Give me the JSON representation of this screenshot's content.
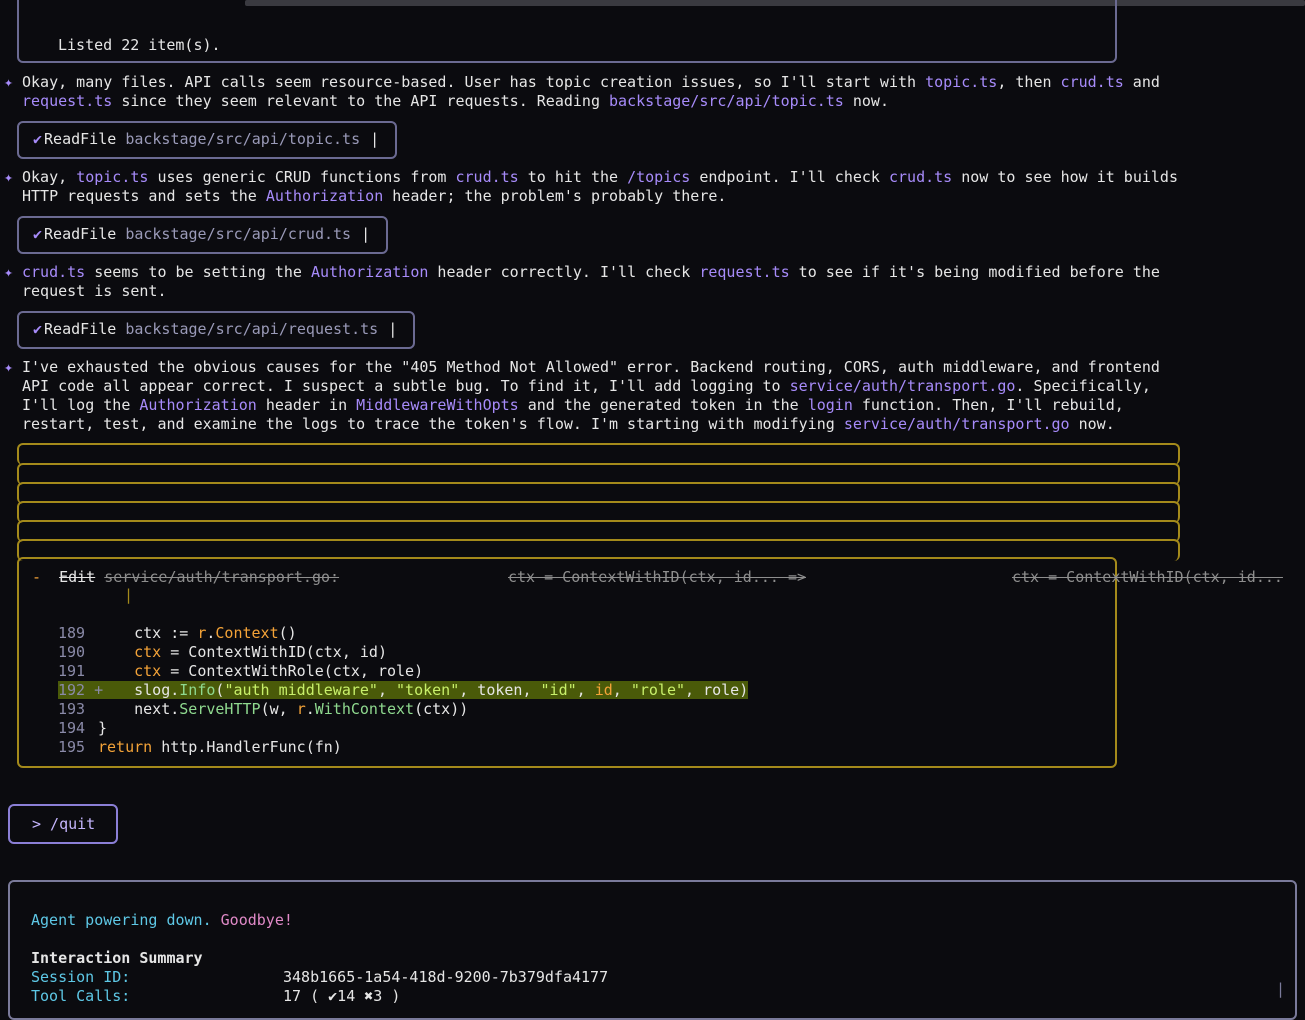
{
  "top_listing": "Listed 22 item(s).",
  "messages": [
    {
      "parts": [
        [
          "t",
          "Okay, many files. API calls seem resource-based. User has topic creation issues, so I'll start with "
        ],
        [
          "h",
          "topic.ts"
        ],
        [
          "t",
          ", then "
        ],
        [
          "h",
          "crud.ts"
        ],
        [
          "t",
          " and"
        ],
        [
          "br",
          ""
        ],
        [
          "h",
          "request.ts"
        ],
        [
          "t",
          " since they seem relevant to the API requests. Reading "
        ],
        [
          "h",
          "backstage/src/api/topic.ts"
        ],
        [
          "t",
          " now."
        ]
      ]
    },
    {
      "parts": [
        [
          "t",
          "Okay, "
        ],
        [
          "h",
          "topic.ts"
        ],
        [
          "t",
          " uses generic CRUD functions from "
        ],
        [
          "h",
          "crud.ts"
        ],
        [
          "t",
          " to hit the "
        ],
        [
          "h",
          "/topics"
        ],
        [
          "t",
          " endpoint. I'll check "
        ],
        [
          "h",
          "crud.ts"
        ],
        [
          "t",
          " now to see how it builds"
        ],
        [
          "br",
          ""
        ],
        [
          "t",
          "HTTP requests and sets the "
        ],
        [
          "h",
          "Authorization"
        ],
        [
          "t",
          " header; the problem's probably there."
        ]
      ]
    },
    {
      "parts": [
        [
          "h",
          "crud.ts"
        ],
        [
          "t",
          " seems to be setting the "
        ],
        [
          "h",
          "Authorization"
        ],
        [
          "t",
          " header correctly. I'll check "
        ],
        [
          "h",
          "request.ts"
        ],
        [
          "t",
          " to see if it's being modified before the"
        ],
        [
          "br",
          ""
        ],
        [
          "t",
          "request is sent."
        ]
      ]
    },
    {
      "parts": [
        [
          "t",
          "I've exhausted the obvious causes for the \"405 Method Not Allowed\" error. Backend routing, CORS, auth middleware, and frontend"
        ],
        [
          "br",
          ""
        ],
        [
          "t",
          "API code all appear correct. I suspect a subtle bug. To find it, I'll add logging to "
        ],
        [
          "h",
          "service/auth/transport.go"
        ],
        [
          "t",
          ". Specifically,"
        ],
        [
          "br",
          ""
        ],
        [
          "t",
          "I'll log the "
        ],
        [
          "h",
          "Authorization"
        ],
        [
          "t",
          " header in "
        ],
        [
          "h",
          "MiddlewareWithOpts"
        ],
        [
          "t",
          " and the generated token in the "
        ],
        [
          "h",
          "login"
        ],
        [
          "t",
          " function. Then, I'll rebuild,"
        ],
        [
          "br",
          ""
        ],
        [
          "t",
          "restart, test, and examine the logs to trace the token's flow. I'm starting with modifying "
        ],
        [
          "h",
          "service/auth/transport.go"
        ],
        [
          "t",
          " now."
        ]
      ]
    }
  ],
  "tool_calls": [
    {
      "check": "✔",
      "tool": "ReadFile",
      "path": "backstage/src/api/topic.ts"
    },
    {
      "check": "✔",
      "tool": "ReadFile",
      "path": "backstage/src/api/crud.ts"
    },
    {
      "check": "✔",
      "tool": "ReadFile",
      "path": "backstage/src/api/request.ts"
    }
  ],
  "edit": {
    "marker": "-",
    "tool": "Edit",
    "path": "service/auth/transport.go:",
    "old_snippet": "ctx = ContextWithID(ctx, id... =>",
    "new_snippet": "ctx = ContextWithID(ctx, id..."
  },
  "code_lines": [
    {
      "n": "189",
      "mark": "",
      "parts": [
        [
          "t",
          "    ctx := "
        ],
        [
          "k",
          "r"
        ],
        [
          "t",
          "."
        ],
        [
          "k",
          "Context"
        ],
        [
          "t",
          "()"
        ]
      ]
    },
    {
      "n": "190",
      "mark": "",
      "parts": [
        [
          "t",
          "    "
        ],
        [
          "k",
          "ctx"
        ],
        [
          "t",
          " = ContextWithID(ctx, id)"
        ]
      ]
    },
    {
      "n": "191",
      "mark": "",
      "parts": [
        [
          "t",
          "    "
        ],
        [
          "k",
          "ctx"
        ],
        [
          "t",
          " = ContextWithRole(ctx, role)"
        ]
      ]
    },
    {
      "n": "192",
      "mark": "+",
      "added": true,
      "parts": [
        [
          "t",
          "    slog."
        ],
        [
          "f",
          "Info"
        ],
        [
          "t",
          "("
        ],
        [
          "s",
          "\"auth middleware\""
        ],
        [
          "t",
          ", "
        ],
        [
          "s",
          "\"token\""
        ],
        [
          "t",
          ", token, "
        ],
        [
          "s",
          "\"id\""
        ],
        [
          "t",
          ", "
        ],
        [
          "k",
          "id"
        ],
        [
          "t",
          ", "
        ],
        [
          "s",
          "\"role\""
        ],
        [
          "t",
          ", role)"
        ]
      ]
    },
    {
      "n": "193",
      "mark": "",
      "parts": [
        [
          "t",
          "    next."
        ],
        [
          "f",
          "ServeHTTP"
        ],
        [
          "t",
          "(w, "
        ],
        [
          "k",
          "r"
        ],
        [
          "t",
          "."
        ],
        [
          "f",
          "WithContext"
        ],
        [
          "t",
          "(ctx))"
        ]
      ]
    },
    {
      "n": "194",
      "mark": "",
      "parts": [
        [
          "t",
          "}"
        ]
      ]
    },
    {
      "n": "195",
      "mark": "",
      "parts": [
        [
          "k",
          "return"
        ],
        [
          "t",
          " http.HandlerFunc(fn)"
        ]
      ]
    }
  ],
  "prompt": "> /quit",
  "summary": {
    "goodbye_a": "Agent powering down.",
    "goodbye_b": " Goodbye!",
    "heading": "Interaction Summary",
    "session_label": "Session ID:",
    "session_value": "348b1665-1a54-418d-9200-7b379dfa4177",
    "tool_label": "Tool Calls:",
    "tool_value": "17 ( ✔14 ✖3 )"
  },
  "colors": {
    "accent": "#a78bfa",
    "gold": "#a48a1b",
    "border": "#6b6a92"
  }
}
